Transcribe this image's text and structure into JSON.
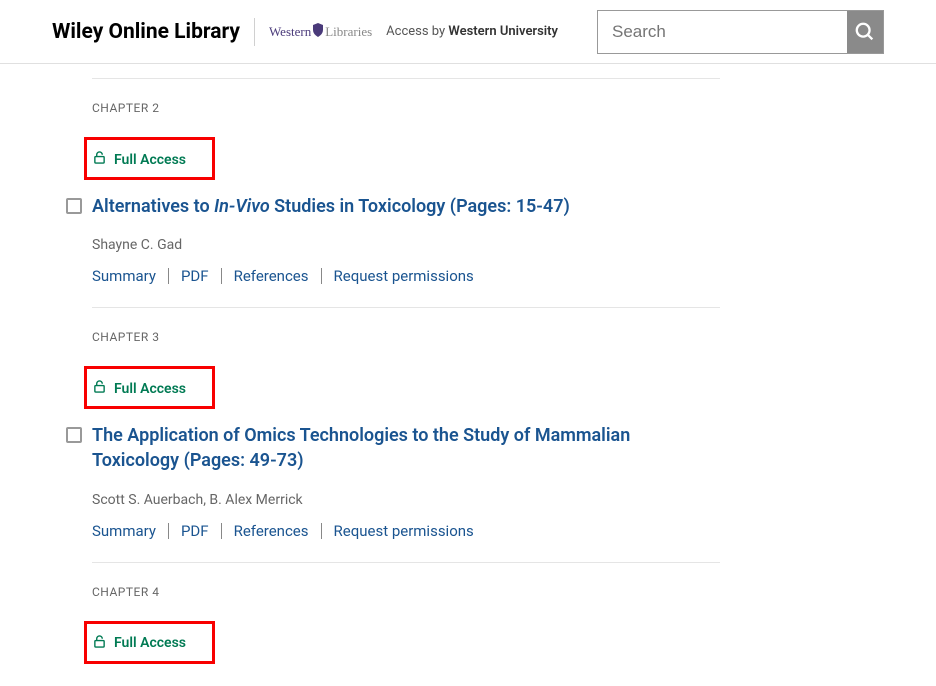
{
  "header": {
    "logo": "Wiley Online Library",
    "western": "Western",
    "libraries": "Libraries",
    "access_by": "Access by",
    "institution": "Western University",
    "search_placeholder": "Search"
  },
  "chapters": [
    {
      "label": "CHAPTER 2",
      "access": "Full Access",
      "title_pre": "Alternatives to ",
      "title_italic": "In-Vivo",
      "title_post": " Studies in Toxicology (Pages: 15-47)",
      "authors": "Shayne C. Gad"
    },
    {
      "label": "CHAPTER 3",
      "access": "Full Access",
      "title_pre": "The Application of Omics Technologies to the Study of Mammalian Toxicology (Pages: 49-73)",
      "title_italic": "",
      "title_post": "",
      "authors": "Scott S. Auerbach,  B. Alex Merrick"
    },
    {
      "label": "CHAPTER 4",
      "access": "Full Access",
      "title_pre": "",
      "title_italic": "",
      "title_post": "",
      "authors": ""
    }
  ],
  "actions": {
    "summary": "Summary",
    "pdf": "PDF",
    "references": "References",
    "permissions": "Request permissions"
  }
}
